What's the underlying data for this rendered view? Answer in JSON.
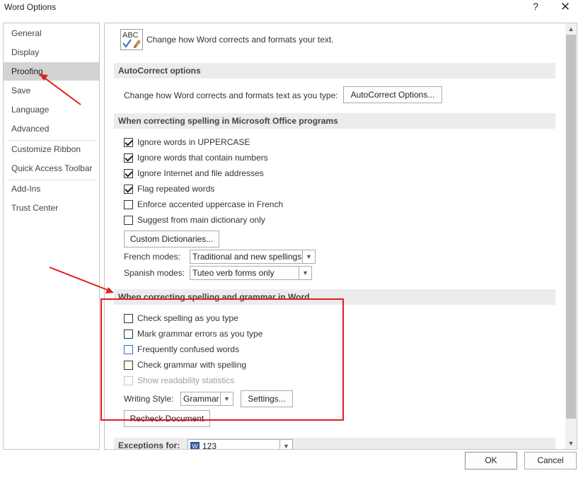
{
  "window": {
    "title": "Word Options",
    "help_label": "?",
    "close_label": "✕"
  },
  "nav": {
    "items": [
      {
        "label": "General"
      },
      {
        "label": "Display"
      },
      {
        "label": "Proofing"
      },
      {
        "label": "Save"
      },
      {
        "label": "Language"
      },
      {
        "label": "Advanced"
      },
      {
        "label": "Customize Ribbon"
      },
      {
        "label": "Quick Access Toolbar"
      },
      {
        "label": "Add-Ins"
      },
      {
        "label": "Trust Center"
      }
    ],
    "active": "Proofing"
  },
  "header": {
    "icon_text": "ABC",
    "text": "Change how Word corrects and formats your text."
  },
  "autocorrect": {
    "title": "AutoCorrect options",
    "description": "Change how Word corrects and formats text as you type:",
    "button": "AutoCorrect Options..."
  },
  "office_spelling": {
    "title": "When correcting spelling in Microsoft Office programs",
    "options": [
      {
        "label": "Ignore words in UPPERCASE",
        "checked": true
      },
      {
        "label": "Ignore words that contain numbers",
        "checked": true
      },
      {
        "label": "Ignore Internet and file addresses",
        "checked": true
      },
      {
        "label": "Flag repeated words",
        "checked": true
      },
      {
        "label": "Enforce accented uppercase in French",
        "checked": false
      },
      {
        "label": "Suggest from main dictionary only",
        "checked": false
      }
    ],
    "custom_dictionaries_button": "Custom Dictionaries...",
    "french_modes_label": "French modes:",
    "french_modes_value": "Traditional and new spellings",
    "spanish_modes_label": "Spanish modes:",
    "spanish_modes_value": "Tuteo verb forms only"
  },
  "word_spelling": {
    "title": "When correcting spelling and grammar in Word",
    "options": [
      {
        "label": "Check spelling as you type",
        "checked": false
      },
      {
        "label": "Mark grammar errors as you type",
        "checked": false
      },
      {
        "label": "Frequently confused words",
        "checked": false
      },
      {
        "label": "Check grammar with spelling",
        "checked": false
      },
      {
        "label": "Show readability statistics",
        "checked": false,
        "disabled": true
      }
    ],
    "writing_style_label": "Writing Style:",
    "writing_style_value": "Grammar",
    "settings_button": "Settings...",
    "recheck_button": "Recheck Document"
  },
  "exceptions": {
    "label": "Exceptions for:",
    "document_value": "123"
  },
  "footer": {
    "ok_label": "OK",
    "cancel_label": "Cancel"
  },
  "colors": {
    "annotation_red": "#e0201e",
    "nav_active": "#d3d3d3",
    "section_bg": "#ececec"
  }
}
